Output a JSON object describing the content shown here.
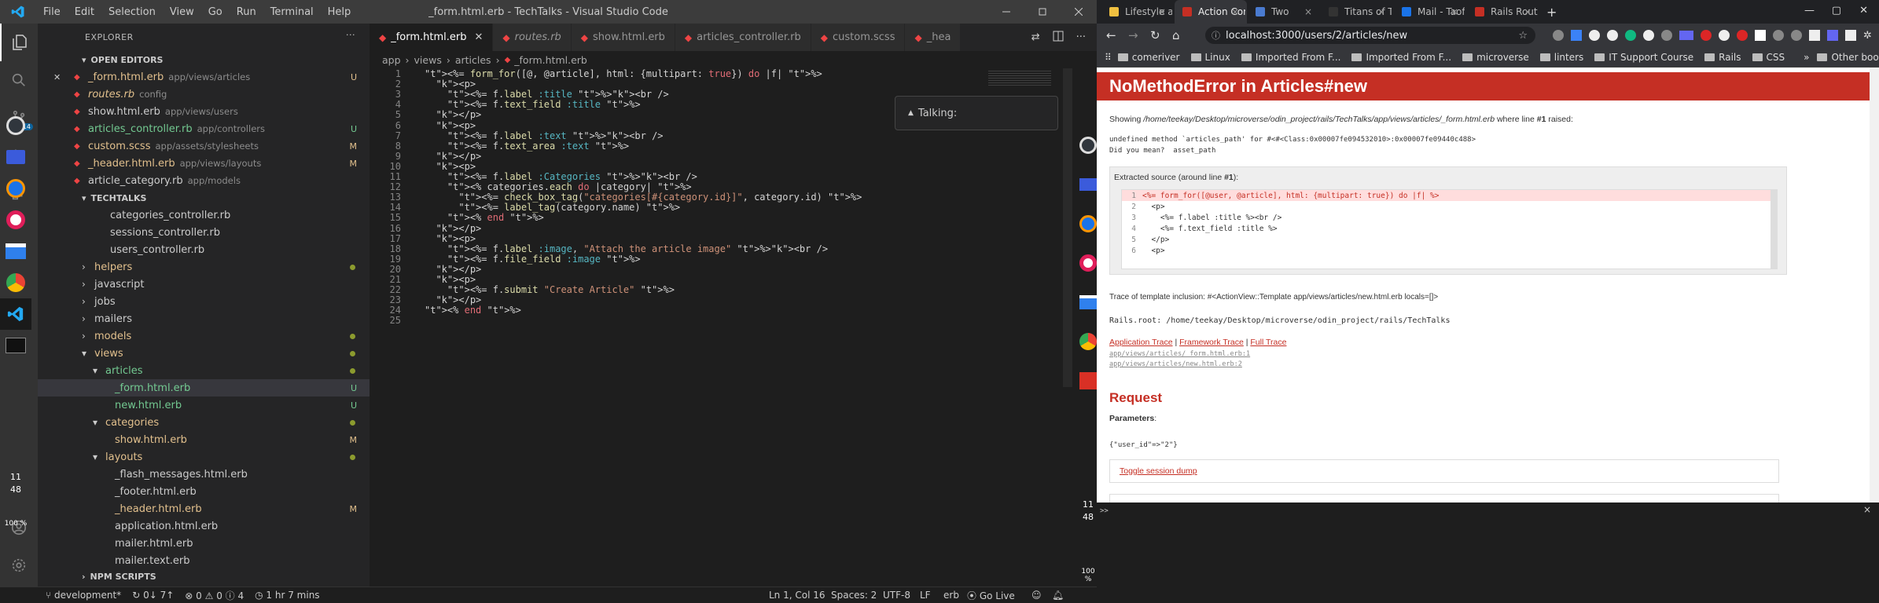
{
  "vscode": {
    "window_title": "_form.html.erb - TechTalks - Visual Studio Code",
    "menu": [
      "File",
      "Edit",
      "Selection",
      "View",
      "Go",
      "Run",
      "Terminal",
      "Help"
    ],
    "explorer_title": "EXPLORER",
    "open_editors_title": "OPEN EDITORS",
    "open_editors": [
      {
        "name": "_form.html.erb",
        "path": "app/views/articles",
        "badge": "U",
        "color": "#e2c08d",
        "close": "✕"
      },
      {
        "name": "routes.rb",
        "path": "config",
        "badge": "",
        "color": "#e2c08d",
        "italic": true
      },
      {
        "name": "show.html.erb",
        "path": "app/views/users",
        "badge": "",
        "color": "#ccc"
      },
      {
        "name": "articles_controller.rb",
        "path": "app/controllers",
        "badge": "U",
        "color": "#73c991"
      },
      {
        "name": "custom.scss",
        "path": "app/assets/stylesheets",
        "badge": "M",
        "color": "#e2c08d"
      },
      {
        "name": "_header.html.erb",
        "path": "app/views/layouts",
        "badge": "M",
        "color": "#e2c08d"
      },
      {
        "name": "article_category.rb",
        "path": "app/models",
        "badge": "",
        "color": "#ccc"
      }
    ],
    "project_title": "TECHTALKS",
    "tree": [
      {
        "name": "categories_controller.rb",
        "indent": 1,
        "kind": "file",
        "color": "#ccc"
      },
      {
        "name": "sessions_controller.rb",
        "indent": 1,
        "kind": "file",
        "color": "#ccc"
      },
      {
        "name": "users_controller.rb",
        "indent": 1,
        "kind": "file",
        "color": "#ccc"
      },
      {
        "name": "helpers",
        "indent": 0,
        "kind": "folder",
        "open": false,
        "dot": true,
        "color": "#e2c08d"
      },
      {
        "name": "javascript",
        "indent": 0,
        "kind": "folder",
        "open": false,
        "color": "#ccc"
      },
      {
        "name": "jobs",
        "indent": 0,
        "kind": "folder",
        "open": false,
        "color": "#ccc"
      },
      {
        "name": "mailers",
        "indent": 0,
        "kind": "folder",
        "open": false,
        "color": "#ccc"
      },
      {
        "name": "models",
        "indent": 0,
        "kind": "folder",
        "open": false,
        "dot": true,
        "color": "#e2c08d"
      },
      {
        "name": "views",
        "indent": 0,
        "kind": "folder",
        "open": true,
        "dot": true,
        "color": "#e2c08d"
      },
      {
        "name": "articles",
        "indent": 1,
        "kind": "folder",
        "open": true,
        "dot": true,
        "color": "#73c991"
      },
      {
        "name": "_form.html.erb",
        "indent": 2,
        "kind": "file",
        "badge": "U",
        "color": "#73c991",
        "selected": true
      },
      {
        "name": "new.html.erb",
        "indent": 2,
        "kind": "file",
        "badge": "U",
        "color": "#73c991"
      },
      {
        "name": "categories",
        "indent": 1,
        "kind": "folder",
        "open": true,
        "dot": true,
        "color": "#e2c08d"
      },
      {
        "name": "show.html.erb",
        "indent": 2,
        "kind": "file",
        "badge": "M",
        "color": "#e2c08d"
      },
      {
        "name": "layouts",
        "indent": 1,
        "kind": "folder",
        "open": true,
        "dot": true,
        "color": "#e2c08d"
      },
      {
        "name": "_flash_messages.html.erb",
        "indent": 2,
        "kind": "file",
        "color": "#ccc"
      },
      {
        "name": "_footer.html.erb",
        "indent": 2,
        "kind": "file",
        "color": "#ccc"
      },
      {
        "name": "_header.html.erb",
        "indent": 2,
        "kind": "file",
        "badge": "M",
        "color": "#e2c08d"
      },
      {
        "name": "application.html.erb",
        "indent": 2,
        "kind": "file",
        "color": "#ccc"
      },
      {
        "name": "mailer.html.erb",
        "indent": 2,
        "kind": "file",
        "color": "#ccc"
      },
      {
        "name": "mailer.text.erb",
        "indent": 2,
        "kind": "file",
        "color": "#ccc"
      }
    ],
    "npm_title": "NPM SCRIPTS",
    "tabs": [
      {
        "label": "_form.html.erb",
        "active": true,
        "close": "✕"
      },
      {
        "label": "routes.rb",
        "active": false
      },
      {
        "label": "show.html.erb",
        "active": false
      },
      {
        "label": "articles_controller.rb",
        "active": false
      },
      {
        "label": "custom.scss",
        "active": false
      },
      {
        "label": "_hea",
        "active": false
      }
    ],
    "breadcrumb": [
      "app",
      "views",
      "articles",
      "_form.html.erb"
    ],
    "talking_label": "Talking:",
    "code_lines": [
      "<%= form_for([@, @article], html: {multipart: true}) do |f| %>",
      "  <p>",
      "    <%= f.label :title %><br />",
      "    <%= f.text_field :title %>",
      "  </p>",
      "  <p>",
      "    <%= f.label :text %><br />",
      "    <%= f.text_area :text %>",
      "  </p>",
      "  <p>",
      "    <%= f.label :Categories %><br />",
      "    <% categories.each do |category| %>",
      "      <%= check_box_tag(\"categories[#{category.id}]\", category.id) %>",
      "      <%= label_tag(category.name) %>",
      "    <% end %>",
      "  </p>",
      "  <p>",
      "    <%= f.label :image, \"Attach the article image\" %><br />",
      "    <%= f.file_field :image %>",
      "  </p>",
      "  <p>",
      "    <%= f.submit \"Create Article\" %>",
      "  </p>",
      "<% end %>",
      ""
    ],
    "status": {
      "branch": "development*",
      "sync": "0↓ 7↑",
      "problems": "0",
      "warnings": "0",
      "info": "4",
      "time": "1 hr 7 mins",
      "position": "Ln 1, Col 16",
      "spaces": "Spaces: 2",
      "encoding": "UTF-8",
      "eol": "LF",
      "lang": "erb",
      "golive": "Go Live"
    },
    "dock_clock": [
      "11",
      "48"
    ],
    "dock_battery": "100 %"
  },
  "chrome": {
    "tabs": [
      {
        "label": "Lifestyle article",
        "color": "#f0c040"
      },
      {
        "label": "Action Controller",
        "color": "#c52f24",
        "active": true
      },
      {
        "label": "Two",
        "color": "#4a7bd0"
      },
      {
        "label": "Titans of Tech T",
        "color": "#333"
      },
      {
        "label": "Mail - Taofeek",
        "color": "#1a73e8"
      },
      {
        "label": "Rails Routing fr",
        "color": "#c52f24"
      }
    ],
    "new_tab": "+",
    "url": "localhost:3000/users/2/articles/new",
    "bookmarks": [
      "comeriver",
      "Linux",
      "Imported From F...",
      "Imported From F...",
      "microverse",
      "linters",
      "IT Support Course",
      "Rails",
      "CSS"
    ],
    "bookmarks_more": "»",
    "other_bookmarks": "Other bookmarks",
    "error_title": "NoMethodError in Articles#new",
    "showing_prefix": "Showing ",
    "showing_path": "/home/teekay/Desktop/microverse/odin_project/rails/TechTalks/app/views/articles/_form.html.erb",
    "showing_mid": " where line ",
    "showing_line": "#1",
    "showing_suffix": " raised:",
    "error_msg1": "undefined method `articles_path' for #<#<Class:0x00007fe094532010>:0x00007fe09440c488>",
    "error_msg2": "Did you mean?  asset_path",
    "extracted_prefix": "Extracted source (around line ",
    "extracted_line": "#1",
    "extracted_suffix": "):",
    "source": [
      {
        "n": "1",
        "code": "<%= form_for([@user, @article], html: {multipart: true}) do |f| %>",
        "hl": true
      },
      {
        "n": "2",
        "code": "  <p>"
      },
      {
        "n": "3",
        "code": "    <%= f.label :title %><br />"
      },
      {
        "n": "4",
        "code": "    <%= f.text_field :title %>"
      },
      {
        "n": "5",
        "code": "  </p>"
      },
      {
        "n": "6",
        "code": "  <p>"
      }
    ],
    "trace_inclusion": "Trace of template inclusion: #<ActionView::Template app/views/articles/new.html.erb locals=[]>",
    "rails_root": "Rails.root: /home/teekay/Desktop/microverse/odin_project/rails/TechTalks",
    "trace_links": [
      "Application Trace",
      "Framework Trace",
      "Full Trace"
    ],
    "trace_sep": " | ",
    "trace_files": [
      "app/views/articles/_form.html.erb:1",
      "app/views/articles/new.html.erb:2"
    ],
    "request_heading": "Request",
    "parameters_label": "Parameters",
    "parameters_suffix": ":",
    "parameters_value": "{\"user_id\"=>\"2\"}",
    "toggle_session": "Toggle session dump",
    "terminal_prompt": ">>",
    "terminal_close": "×"
  }
}
